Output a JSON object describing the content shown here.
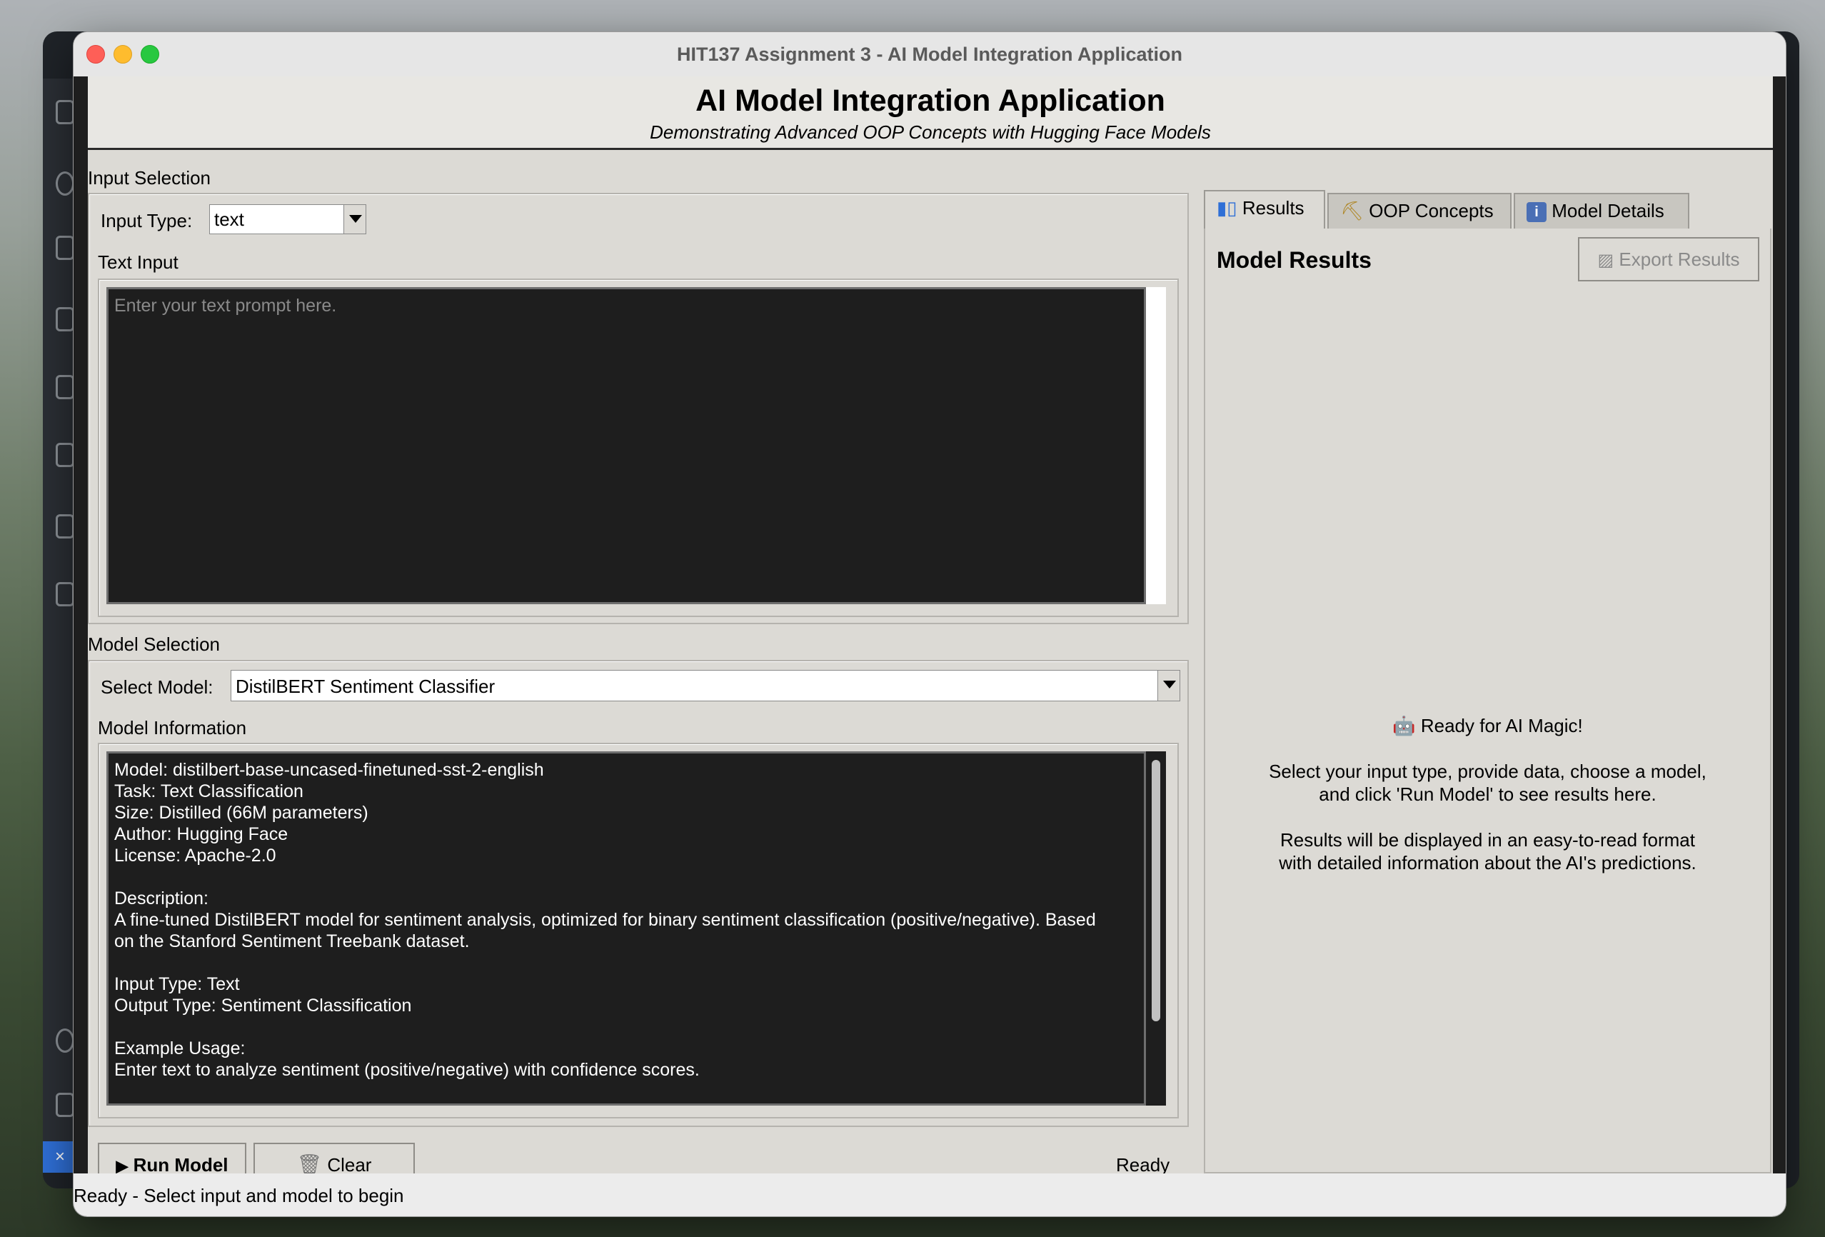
{
  "window": {
    "title": "HIT137 Assignment 3 - AI Model Integration Application"
  },
  "header": {
    "title": "AI Model Integration Application",
    "subtitle": "Demonstrating Advanced OOP Concepts with Hugging Face Models"
  },
  "input_section": {
    "title": "Input Selection",
    "input_type_label": "Input Type:",
    "input_type_value": "text",
    "text_input_label": "Text Input",
    "text_placeholder": "Enter your text prompt here."
  },
  "model_section": {
    "title": "Model Selection",
    "select_label": "Select Model:",
    "selected_model": "DistilBERT Sentiment Classifier",
    "info_label": "Model Information",
    "info_lines": [
      "Model: distilbert-base-uncased-finetuned-sst-2-english",
      "Task: Text Classification",
      "Size: Distilled (66M parameters)",
      "Author: Hugging Face",
      "License: Apache-2.0",
      "",
      "Description:",
      "A fine-tuned DistilBERT model for sentiment analysis, optimized for binary sentiment classification (positive/negative). Based",
      "on the Stanford Sentiment Treebank dataset.",
      "",
      "Input Type: Text",
      "Output Type: Sentiment Classification",
      "",
      "Example Usage:",
      "Enter text to analyze sentiment (positive/negative) with confidence scores."
    ]
  },
  "actions": {
    "run_label": "Run Model",
    "clear_label": "Clear",
    "status": "Ready"
  },
  "tabs": [
    {
      "label": "Results",
      "icon": "chart-icon",
      "active": true
    },
    {
      "label": "OOP Concepts",
      "icon": "oop-icon",
      "active": false
    },
    {
      "label": "Model Details",
      "icon": "info-icon",
      "active": false
    }
  ],
  "results": {
    "title": "Model Results",
    "export_label": "Export Results",
    "ready_title": "Ready for AI Magic!",
    "lines": [
      "Select your input type, provide data, choose a model,",
      "and click 'Run Model' to see results here.",
      "",
      "Results will be displayed in an easy-to-read format",
      "with detailed information about the AI's predictions."
    ]
  },
  "statusbar": {
    "text": "Ready - Select input and model to begin"
  },
  "colors": {
    "accent_blue": "#2f6fd6",
    "text_area_bg": "#1e1e1e",
    "panel_bg": "#dcdad5"
  }
}
